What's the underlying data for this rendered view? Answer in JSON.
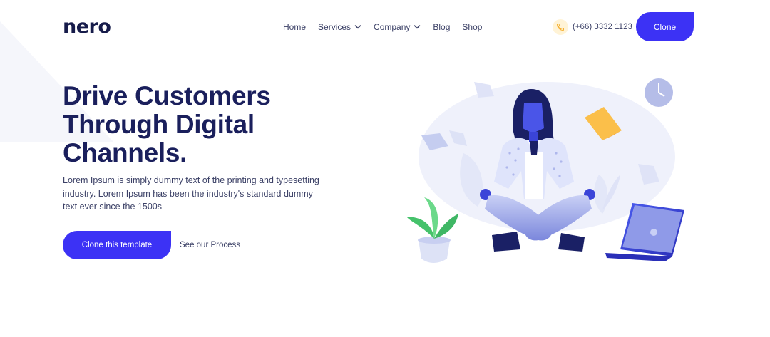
{
  "header": {
    "logo": "nero",
    "nav": [
      {
        "label": "Home",
        "has_dropdown": false
      },
      {
        "label": "Services",
        "has_dropdown": true
      },
      {
        "label": "Company",
        "has_dropdown": true
      },
      {
        "label": "Blog",
        "has_dropdown": false
      },
      {
        "label": "Shop",
        "has_dropdown": false
      }
    ],
    "phone": "(+66) 3332 1123",
    "cta_label": "Clone"
  },
  "hero": {
    "title_lines": [
      "Drive Customers",
      "Through Digital",
      "Channels."
    ],
    "description": "Lorem Ipsum is simply dummy text of the printing and typesetting industry. Lorem Ipsum has been the industry's standard dummy text ever since the 1500s",
    "primary_button": "Clone this template",
    "secondary_link": "See our Process"
  },
  "colors": {
    "accent": "#3c32f5",
    "heading": "#1a1f5c",
    "body_text": "#3b4066",
    "phone_icon_bg": "#fff3d6"
  },
  "icons": {
    "phone": "phone-icon",
    "dropdown": "chevron-down-icon",
    "illustration": "meditating-woman-illustration"
  }
}
